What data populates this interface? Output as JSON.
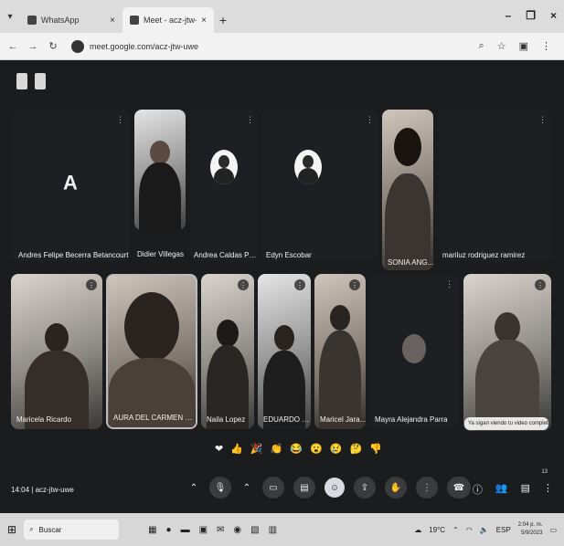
{
  "browser": {
    "tabs": [
      {
        "label": "WhatsApp",
        "active": false
      },
      {
        "label": "Meet - acz-jtw-uwe",
        "active": true
      }
    ],
    "new_tab_icon": "plus",
    "url": "meet.google.com/acz-jtw-uwe",
    "window_controls": [
      "–",
      "❐",
      "×"
    ]
  },
  "meet": {
    "meeting_time": "14:04",
    "meeting_code": "acz-jtw-uwe",
    "participants_count": "13",
    "captions_text": "Ya sigan viendo tu video completo",
    "participants": [
      {
        "name": "Andres Felipe Becerra Betancourt",
        "avatar": "A"
      },
      {
        "name": "Didier Villegas"
      },
      {
        "name": "Andrea Caldas Pos..."
      },
      {
        "name": "Edyn Escobar"
      },
      {
        "name": "SONIA ANG..."
      },
      {
        "name": "mariluz rodriguez ramirez"
      },
      {
        "name": "Maricela Ricardo"
      },
      {
        "name": "AURA DEL CARMEN GON..."
      },
      {
        "name": "Naila Lopez"
      },
      {
        "name": "EDUARDO SI..."
      },
      {
        "name": "Maricel Jara..."
      },
      {
        "name": "Mayra Alejandra Parra"
      },
      {
        "name": ""
      }
    ],
    "reactions": [
      "❤",
      "👍",
      "🎉",
      "👏",
      "😂",
      "😮",
      "😢",
      "🤔",
      "👎"
    ],
    "controls": [
      "mic-icon",
      "camera-icon",
      "captions-icon",
      "emoji-icon",
      "present-icon",
      "hand-icon",
      "more-icon",
      "leave-icon"
    ],
    "side_controls": [
      "info-icon",
      "people-icon",
      "chat-icon",
      "activities-icon"
    ]
  },
  "taskbar": {
    "search_label": "Buscar",
    "weather": "19°C",
    "language": "ESP",
    "time": "2:04 p. m.",
    "date": "5/9/2023"
  }
}
